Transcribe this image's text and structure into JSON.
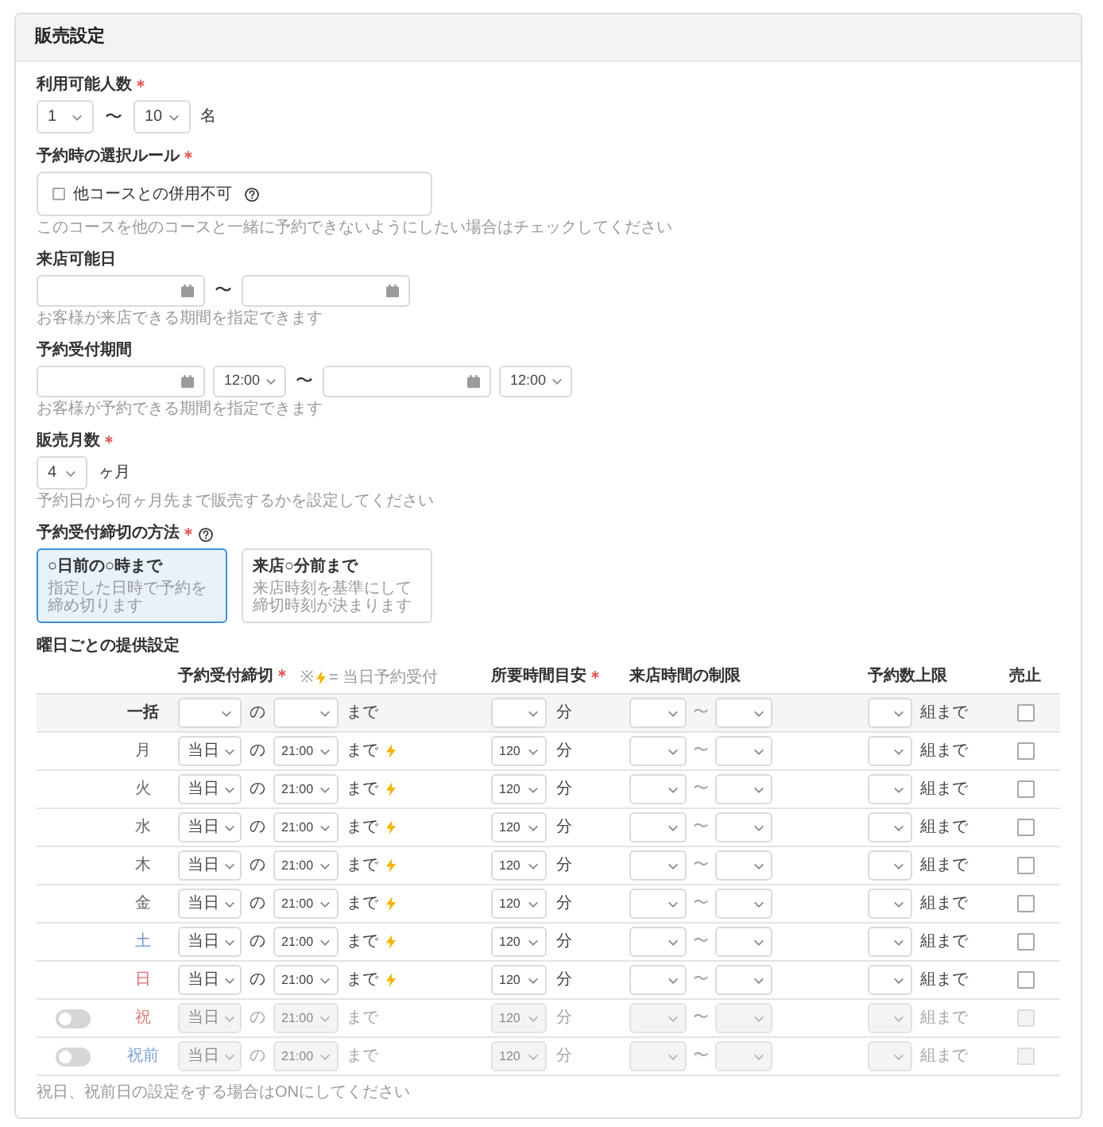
{
  "header": {
    "title": "販売設定"
  },
  "party_size": {
    "label": "利用可能人数",
    "required": true,
    "min": "1",
    "separator": "〜",
    "max": "10",
    "unit": "名"
  },
  "selection_rule": {
    "label": "予約時の選択ルール",
    "required": true,
    "option": {
      "label": "他コースとの併用不可",
      "checked": false
    },
    "hint": "このコースを他のコースと一緒に予約できないようにしたい場合はチェックしてください"
  },
  "visit_dates": {
    "label": "来店可能日",
    "required": false,
    "fields": [
      {
        "kind": "date"
      },
      {
        "kind": "separator",
        "text": "〜"
      },
      {
        "kind": "date"
      }
    ],
    "hint": "お客様が来店できる期間を指定できます"
  },
  "booking_period": {
    "label": "予約受付期間",
    "required": false,
    "fields": [
      {
        "kind": "date"
      },
      {
        "kind": "time",
        "value": "12:00"
      },
      {
        "kind": "separator",
        "text": "〜"
      },
      {
        "kind": "date"
      },
      {
        "kind": "time",
        "value": "12:00"
      }
    ],
    "hint": "お客様が予約できる期間を指定できます"
  },
  "sales_months": {
    "label": "販売月数",
    "required": true,
    "value": "4",
    "unit": "ヶ月",
    "hint": "予約日から何ヶ月先まで販売するかを設定してください"
  },
  "deadline_method": {
    "label": "予約受付締切の方法",
    "required": true,
    "options": [
      {
        "title": "○日前の○時まで",
        "description": "指定した日時で予約を締め切ります",
        "selected": true
      },
      {
        "title": "来店○分前まで",
        "description": "来店時刻を基準にして締切時刻が決まります",
        "selected": false
      }
    ]
  },
  "weekly": {
    "title": "曜日ごとの提供設定",
    "columns": [
      {
        "label": "予約受付締切",
        "required": true
      },
      {
        "label": "所要時間目安",
        "required": true
      },
      {
        "label": "来店時間の制限",
        "required": false
      },
      {
        "label": "予約数上限",
        "required": false
      },
      {
        "label": "売止",
        "required": false
      }
    ],
    "legend": {
      "mark": "※",
      "text": "= 当日予約受付"
    },
    "rows": [
      {
        "kind": "bulk",
        "day": "一括",
        "color": "#333333",
        "of": "の",
        "until": "まで",
        "same_day": false,
        "minutes_unit": "分",
        "range_separator": "〜",
        "limit_unit": "組まで",
        "sold_out": false
      },
      {
        "kind": "day",
        "day": "月",
        "color": "#666666",
        "deadline_day": "当日",
        "of": "の",
        "deadline_time": "21:00",
        "until": "まで",
        "same_day": true,
        "duration": "120",
        "minutes_unit": "分",
        "range_separator": "〜",
        "limit_unit": "組まで",
        "sold_out": false
      },
      {
        "kind": "day",
        "day": "火",
        "color": "#666666",
        "deadline_day": "当日",
        "of": "の",
        "deadline_time": "21:00",
        "until": "まで",
        "same_day": true,
        "duration": "120",
        "minutes_unit": "分",
        "range_separator": "〜",
        "limit_unit": "組まで",
        "sold_out": false
      },
      {
        "kind": "day",
        "day": "水",
        "color": "#666666",
        "deadline_day": "当日",
        "of": "の",
        "deadline_time": "21:00",
        "until": "まで",
        "same_day": true,
        "duration": "120",
        "minutes_unit": "分",
        "range_separator": "〜",
        "limit_unit": "組まで",
        "sold_out": false
      },
      {
        "kind": "day",
        "day": "木",
        "color": "#666666",
        "deadline_day": "当日",
        "of": "の",
        "deadline_time": "21:00",
        "until": "まで",
        "same_day": true,
        "duration": "120",
        "minutes_unit": "分",
        "range_separator": "〜",
        "limit_unit": "組まで",
        "sold_out": false
      },
      {
        "kind": "day",
        "day": "金",
        "color": "#666666",
        "deadline_day": "当日",
        "of": "の",
        "deadline_time": "21:00",
        "until": "まで",
        "same_day": true,
        "duration": "120",
        "minutes_unit": "分",
        "range_separator": "〜",
        "limit_unit": "組まで",
        "sold_out": false
      },
      {
        "kind": "day",
        "day": "土",
        "color": "#6f93cf",
        "deadline_day": "当日",
        "of": "の",
        "deadline_time": "21:00",
        "until": "まで",
        "same_day": true,
        "duration": "120",
        "minutes_unit": "分",
        "range_separator": "〜",
        "limit_unit": "組まで",
        "sold_out": false
      },
      {
        "kind": "day",
        "day": "日",
        "color": "#e46c6c",
        "deadline_day": "当日",
        "of": "の",
        "deadline_time": "21:00",
        "until": "まで",
        "same_day": true,
        "duration": "120",
        "minutes_unit": "分",
        "range_separator": "〜",
        "limit_unit": "組まで",
        "sold_out": false
      },
      {
        "kind": "holiday",
        "on": false,
        "day": "祝",
        "color": "#d98080",
        "deadline_day": "当日",
        "of": "の",
        "deadline_time": "21:00",
        "until": "まで",
        "same_day": false,
        "duration": "120",
        "minutes_unit": "分",
        "range_separator": "〜",
        "limit_unit": "組まで",
        "sold_out": false
      },
      {
        "kind": "holiday",
        "on": false,
        "day": "祝前",
        "color": "#7fa2d8",
        "deadline_day": "当日",
        "of": "の",
        "deadline_time": "21:00",
        "until": "まで",
        "same_day": false,
        "duration": "120",
        "minutes_unit": "分",
        "range_separator": "〜",
        "limit_unit": "組まで",
        "sold_out": false
      }
    ],
    "note": "祝日、祝前日の設定をする場合はONにしてください"
  }
}
